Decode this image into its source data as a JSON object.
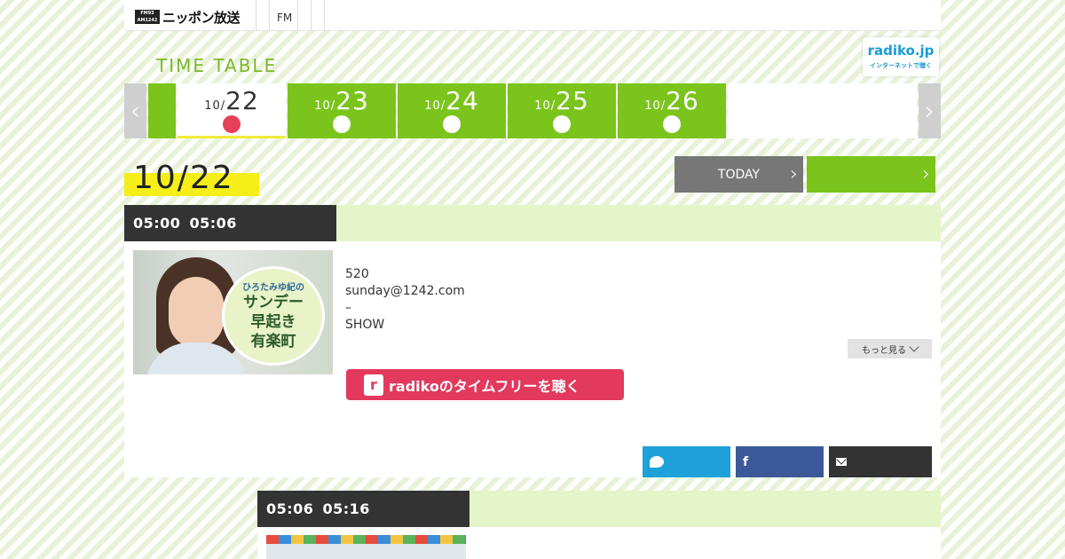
{
  "header": {
    "logo_badge_top": "FM93",
    "logo_badge_bottom": "AM1242",
    "logo_text": "ニッポン放送",
    "nav_fm": "FM"
  },
  "timetable": {
    "heading": "TIME TABLE",
    "radiko_logo_main": "radiko.jp",
    "radiko_logo_sub": "インターネットで聴く"
  },
  "date_tabs": [
    {
      "month": "10/",
      "day": "22",
      "active": true
    },
    {
      "month": "10/",
      "day": "23",
      "active": false
    },
    {
      "month": "10/",
      "day": "24",
      "active": false
    },
    {
      "month": "10/",
      "day": "25",
      "active": false
    },
    {
      "month": "10/",
      "day": "26",
      "active": false
    }
  ],
  "current_date": "10/22",
  "today_button": "TODAY",
  "programs": [
    {
      "time_start": "05:00",
      "time_end": "05:06",
      "image_title_small": "ひろたみゆ紀の",
      "image_title_lines": [
        "サンデー",
        "早起き",
        "有楽町"
      ],
      "details": [
        "520",
        "sunday@1242.com",
        "–",
        "SHOW"
      ],
      "more_label": "もっと見る",
      "radiko_button_label": "radikoのタイムフリーを聴く",
      "radiko_icon_letter": "r"
    },
    {
      "time_start": "05:06",
      "time_end": "05:16"
    }
  ],
  "share": {
    "twitter_glyph": "twitter-icon",
    "facebook_glyph": "f",
    "mail_glyph": "mail-icon"
  },
  "colors": {
    "green": "#7ac41c",
    "dark": "#333333",
    "light_green": "#e4f5c9",
    "highlight_yellow": "#f5ee19",
    "radiko_pink": "#e2395d",
    "twitter_blue": "#1da1d8",
    "facebook_blue": "#3b5998"
  }
}
